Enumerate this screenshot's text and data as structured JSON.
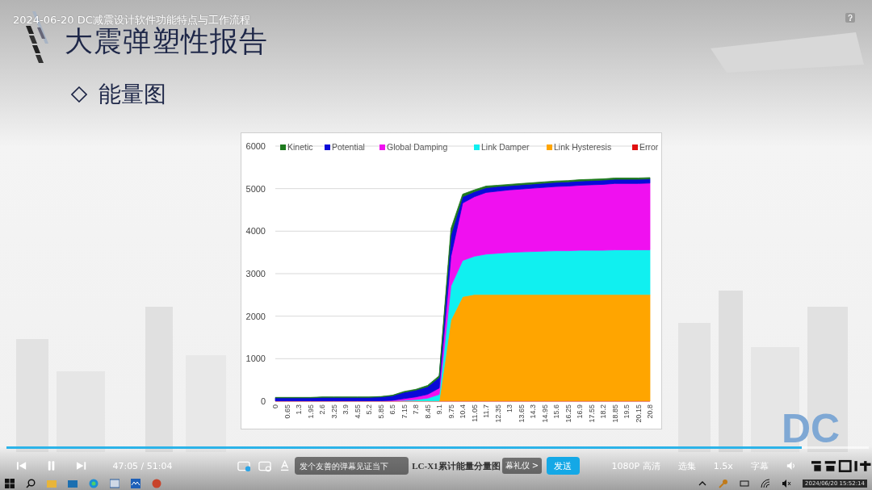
{
  "video": {
    "title": "2024-06-20 DC减震设计软件功能特点与工作流程"
  },
  "slide": {
    "title": "大震弹塑性报告",
    "subtitle": "能量图",
    "corner_logo": "DC",
    "caption": "LC-X1累计能量分量图",
    "chart_data": {
      "type": "area",
      "stacked": true,
      "grid": true,
      "legend": true,
      "categories": [
        "0",
        "0.65",
        "1.3",
        "1.95",
        "2.6",
        "3.25",
        "3.9",
        "4.55",
        "5.2",
        "5.85",
        "6.5",
        "7.15",
        "7.8",
        "8.45",
        "9.1",
        "9.75",
        "10.4",
        "11.05",
        "11.7",
        "12.35",
        "13",
        "13.65",
        "14.3",
        "14.95",
        "15.6",
        "16.25",
        "16.9",
        "17.55",
        "18.2",
        "18.85",
        "19.5",
        "20.15",
        "20.8"
      ],
      "ylim": [
        0,
        6000
      ],
      "yticks": [
        0,
        1000,
        2000,
        3000,
        4000,
        5000,
        6000
      ],
      "series": [
        {
          "name": "Error",
          "color": "#e01010",
          "values": [
            10,
            10,
            10,
            10,
            10,
            10,
            10,
            10,
            10,
            10,
            10,
            10,
            10,
            10,
            10,
            10,
            10,
            10,
            10,
            10,
            10,
            10,
            10,
            10,
            10,
            10,
            10,
            10,
            10,
            10,
            10,
            10,
            10
          ]
        },
        {
          "name": "Link Hysteresis",
          "color": "#ffa500",
          "values": [
            0,
            0,
            0,
            0,
            0,
            0,
            0,
            0,
            0,
            0,
            0,
            0,
            0,
            0,
            0,
            1900,
            2450,
            2500,
            2500,
            2500,
            2500,
            2500,
            2500,
            2500,
            2500,
            2500,
            2500,
            2500,
            2500,
            2500,
            2500,
            2500,
            2500
          ]
        },
        {
          "name": "Link Damper",
          "color": "#10f0f0",
          "values": [
            0,
            0,
            0,
            0,
            0,
            0,
            0,
            0,
            0,
            0,
            0,
            10,
            30,
            60,
            150,
            800,
            850,
            900,
            950,
            970,
            990,
            1000,
            1010,
            1020,
            1030,
            1030,
            1040,
            1040,
            1040,
            1050,
            1050,
            1050,
            1050
          ]
        },
        {
          "name": "Global Damping",
          "color": "#f010f0",
          "values": [
            0,
            0,
            0,
            0,
            0,
            0,
            0,
            0,
            0,
            0,
            10,
            40,
            60,
            90,
            150,
            700,
            1350,
            1400,
            1450,
            1460,
            1470,
            1480,
            1490,
            1500,
            1510,
            1520,
            1530,
            1540,
            1550,
            1560,
            1560,
            1560,
            1570
          ]
        },
        {
          "name": "Potential",
          "color": "#0a0ad8",
          "values": [
            70,
            70,
            70,
            70,
            80,
            80,
            80,
            80,
            80,
            90,
            110,
            150,
            160,
            180,
            250,
            500,
            150,
            120,
            110,
            110,
            100,
            100,
            100,
            100,
            100,
            100,
            100,
            100,
            100,
            100,
            100,
            100,
            100
          ]
        },
        {
          "name": "Kinetic",
          "color": "#1e7a1e",
          "values": [
            10,
            10,
            10,
            10,
            10,
            10,
            10,
            10,
            10,
            10,
            10,
            20,
            20,
            30,
            40,
            150,
            60,
            40,
            40,
            30,
            30,
            30,
            30,
            30,
            30,
            30,
            30,
            30,
            30,
            30,
            30,
            30,
            30
          ]
        }
      ]
    }
  },
  "player": {
    "progress": {
      "level": 0.922
    },
    "time": "47:05 / 51:04",
    "danmaku_input": {
      "placeholder": "发个友善的弹幕见证当下"
    },
    "etiquette_link": "幕礼仪 >",
    "send_button": "发送",
    "controls": [
      "1080P 高清",
      "选集",
      "1.5x",
      "字幕"
    ]
  },
  "taskbar": {
    "clock": "2024/06/20 15:52:14"
  }
}
